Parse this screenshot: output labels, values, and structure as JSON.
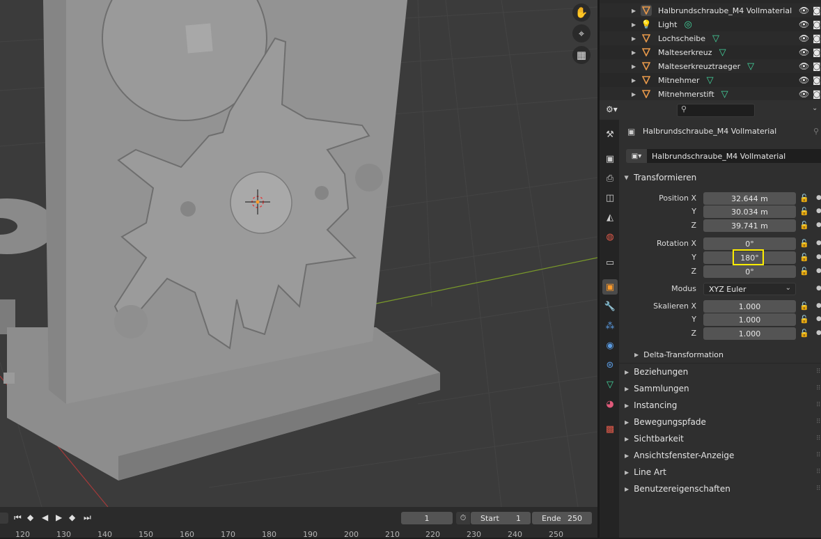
{
  "outliner": {
    "items": [
      {
        "name": "Halbrundschraube_M4 Vollmaterial",
        "icon": "mesh-object-icon",
        "has_mesh_tag": false,
        "selected": true
      },
      {
        "name": "Light",
        "icon": "light-icon",
        "has_mesh_tag": false,
        "light_tag": true
      },
      {
        "name": "Lochscheibe",
        "icon": "mesh-object-icon",
        "has_mesh_tag": true
      },
      {
        "name": "Malteserkreuz",
        "icon": "mesh-object-icon",
        "has_mesh_tag": true
      },
      {
        "name": "Malteserkreuztraeger",
        "icon": "mesh-object-icon",
        "has_mesh_tag": true
      },
      {
        "name": "Mitnehmer",
        "icon": "mesh-object-icon",
        "has_mesh_tag": true
      },
      {
        "name": "Mitnehmerstift",
        "icon": "mesh-object-icon",
        "has_mesh_tag": true
      }
    ]
  },
  "properties": {
    "object_title": "Halbrundschraube_M4 Vollmaterial",
    "object_name_field": "Halbrundschraube_M4 Vollmaterial",
    "transform_panel": "Transformieren",
    "position": {
      "label_x": "Position X",
      "label_y": "Y",
      "label_z": "Z",
      "x": "32.644 m",
      "y": "30.034 m",
      "z": "39.741 m"
    },
    "rotation": {
      "label_x": "Rotation X",
      "label_y": "Y",
      "label_z": "Z",
      "x": "0°",
      "y": "180°",
      "z": "0°"
    },
    "mode": {
      "label": "Modus",
      "value": "XYZ Euler"
    },
    "scale": {
      "label_x": "Skalieren X",
      "label_y": "Y",
      "label_z": "Z",
      "x": "1.000",
      "y": "1.000",
      "z": "1.000"
    },
    "delta": "Delta-Transformation",
    "panels": [
      "Beziehungen",
      "Sammlungen",
      "Instancing",
      "Bewegungspfade",
      "Sichtbarkeit",
      "Ansichtsfenster-Anzeige",
      "Line Art",
      "Benutzereigenschaften"
    ],
    "highlight_color": "#ffee00"
  },
  "timeline": {
    "current_frame": "1",
    "start_label": "Start",
    "start_value": "1",
    "end_label": "Ende",
    "end_value": "250",
    "ticks": [
      "120",
      "130",
      "140",
      "150",
      "160",
      "170",
      "180",
      "190",
      "200",
      "210",
      "220",
      "230",
      "240",
      "250"
    ]
  }
}
